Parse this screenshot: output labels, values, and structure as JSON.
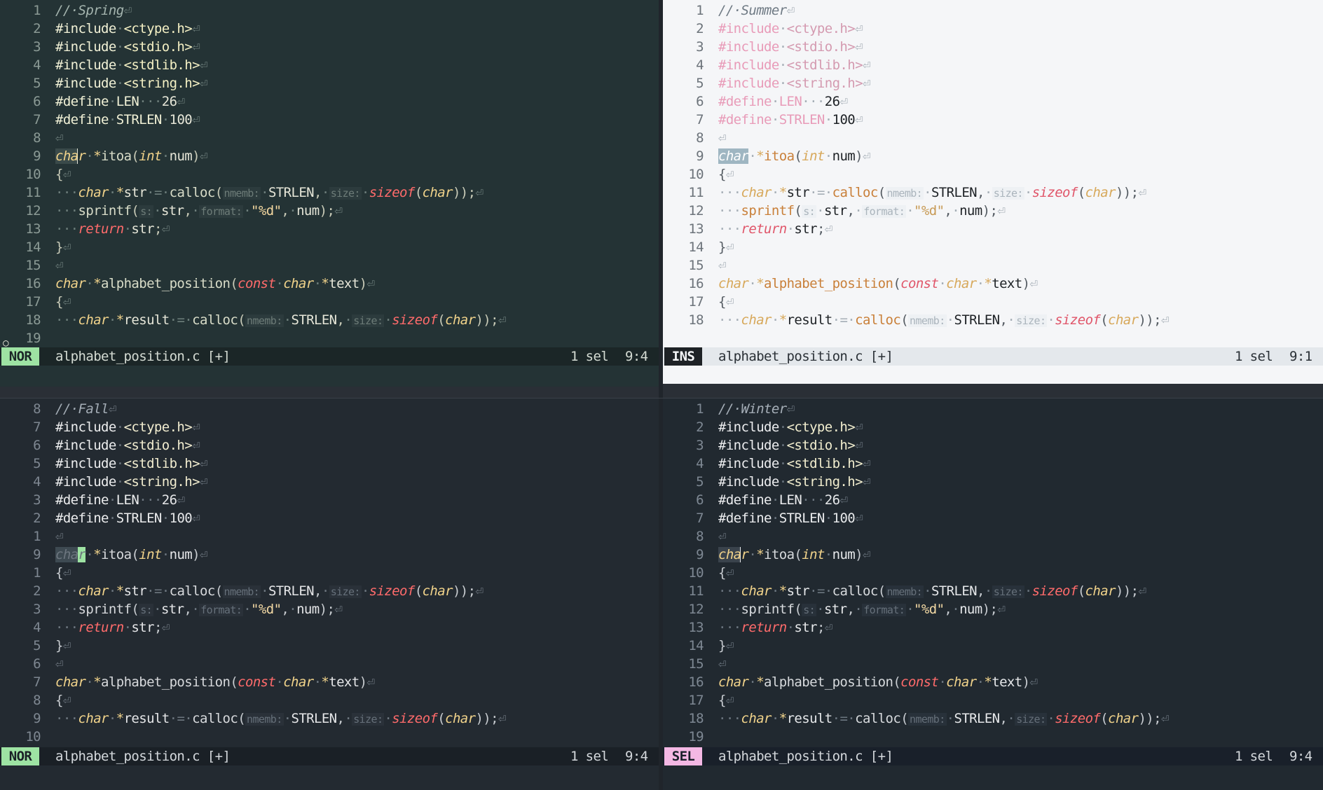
{
  "panes": [
    {
      "theme": "Spring",
      "comment": "//·Spring",
      "line_numbers": [
        "1",
        "2",
        "3",
        "4",
        "5",
        "6",
        "7",
        "8",
        "9",
        "10",
        "11",
        "12",
        "13",
        "14",
        "15",
        "16",
        "17",
        "18",
        "19"
      ],
      "mode": "NOR",
      "filename": "alphabet_position.c [+]",
      "selections": "1 sel",
      "position": "9:4",
      "gutter_icon": "circle-icon"
    },
    {
      "theme": "Summer",
      "comment": "//·Summer",
      "line_numbers": [
        "1",
        "2",
        "3",
        "4",
        "5",
        "6",
        "7",
        "8",
        "9",
        "10",
        "11",
        "12",
        "13",
        "14",
        "15",
        "16",
        "17",
        "18"
      ],
      "mode": "INS",
      "filename": "alphabet_position.c [+]",
      "selections": "1 sel",
      "position": "9:1"
    },
    {
      "theme": "Fall",
      "comment": "//·Fall",
      "line_numbers": [
        "8",
        "7",
        "6",
        "5",
        "4",
        "3",
        "2",
        "1",
        "9",
        "1",
        "2",
        "3",
        "4",
        "5",
        "6",
        "7",
        "8",
        "9",
        "10"
      ],
      "mode": "NOR",
      "filename": "alphabet_position.c [+]",
      "selections": "1 sel",
      "position": "9:4"
    },
    {
      "theme": "Winter",
      "comment": "//·Winter",
      "line_numbers": [
        "1",
        "2",
        "3",
        "4",
        "5",
        "6",
        "7",
        "8",
        "9",
        "10",
        "11",
        "12",
        "13",
        "14",
        "15",
        "16",
        "17",
        "18",
        "19"
      ],
      "mode": "SEL",
      "filename": "alphabet_position.c [+]",
      "selections": "1 sel",
      "position": "9:4"
    }
  ],
  "code": {
    "eol": "⏎",
    "tokens": {
      "include": "#include",
      "define": "#define",
      "ctype": "<ctype.h>",
      "stdio": "<stdio.h>",
      "stdlib": "<stdlib.h>",
      "string": "<string.h>",
      "len": "LEN",
      "len_pad": "···",
      "len_val": "26",
      "strlen": "STRLEN",
      "strlen_val": "100",
      "char": "char",
      "int": "int",
      "const": "const",
      "ptr": "*",
      "itoa": "itoa",
      "num": "num",
      "paren_open": "(",
      "paren_close": ")",
      "brace_open": "{",
      "brace_close": "}",
      "indent": "···",
      "str": "str",
      "result": "result",
      "text": "text",
      "assign": "·=·",
      "calloc": "calloc",
      "hint_nmemb": "nmemb:",
      "hint_size": "size:",
      "hint_s": "s:",
      "hint_format": "format:",
      "sizeof": "sizeof",
      "sprintf": "sprintf",
      "format_str": "\"%d\"",
      "return": "return",
      "alphabet_position": "alphabet_position",
      "comma": ",",
      "semi": ";",
      "semi_close": "));",
      "dot": "·"
    }
  },
  "colors": {
    "spring_bg": "#243335",
    "summer_bg": "#f5f6f8",
    "fall_bg": "#232a31",
    "winter_bg": "#212930",
    "keyword_red": "#ff6b6b",
    "type_yellow": "#f2d48b",
    "nor_mode": "#9ee3a3",
    "sel_mode": "#f4b8e4"
  }
}
